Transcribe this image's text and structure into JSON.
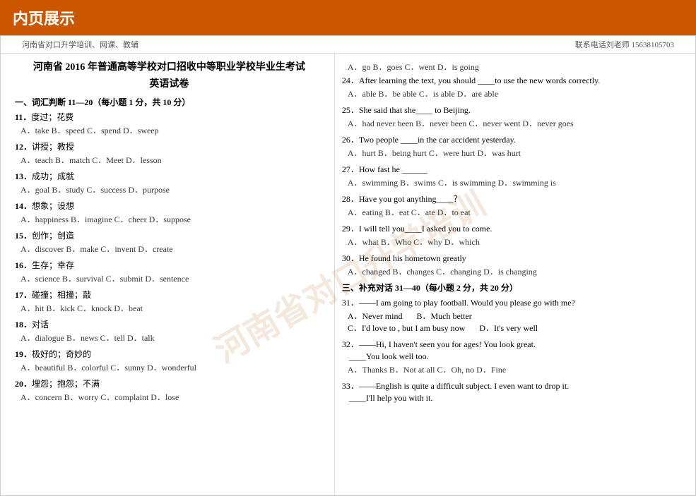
{
  "banner": {
    "title": "内页展示"
  },
  "header": {
    "left": "河南省对口升学培训、网课、教辅",
    "right": "联系电话刘老师 15638105703"
  },
  "exam": {
    "title": "河南省 2016 年普通高等学校对口招收中等职业学校毕业生考试",
    "subtitle": "英语试卷",
    "section1": {
      "header": "一、词汇判断 11—20（每小题 1 分，共 10 分）",
      "questions": [
        {
          "num": "11",
          "zh": "度过；花费",
          "options": "A．take   B．speed   C．spend   D．sweep"
        },
        {
          "num": "12",
          "zh": "讲授；教授",
          "options": "A．teach  B．match  C．Meet   D．lesson"
        },
        {
          "num": "13",
          "zh": "成功；成就",
          "options": "A．goal  B．study  C．success  D．purpose"
        },
        {
          "num": "14",
          "zh": "想象；设想",
          "options": "A．happiness  B．imagine  C．cheer  D．suppose"
        },
        {
          "num": "15",
          "zh": "创作；创造",
          "options": "A．discover  B．make   C．invent  D．create"
        },
        {
          "num": "16",
          "zh": "生存；幸存",
          "options": "A．science  B．survival  C．submit  D．sentence"
        },
        {
          "num": "17",
          "zh": "碰撞；相撞；敲",
          "options": "A．hit     B．kick    C．knock   D．beat"
        },
        {
          "num": "18",
          "zh": "对话",
          "options": "A．dialogue  B．news  C．tell  D．talk"
        },
        {
          "num": "19",
          "zh": "极好的；奇妙的",
          "options": "A．beautiful  B．colorful  C．sunny  D．wonderful"
        },
        {
          "num": "20",
          "zh": "埋怨；抱怨；不满",
          "options": "A．concern  B．worry  C．complaint  D．lose"
        }
      ]
    }
  },
  "right_section": {
    "intro_options": "A．go   B．goes   C．went   D．is going",
    "q24": {
      "text": "24．After learning the text, you should ____to use the new words correctly.",
      "options": "A．able   B．be able  C．is able   D．are able"
    },
    "q25": {
      "text": "25．She said that she____ to Beijing.",
      "options": "A．had never been   B．never been  C．never went  D．never goes"
    },
    "q26": {
      "text": "26．Two people ____in the car accident yesterday.",
      "options": "A．hurt    B．being hurt   C．were hurt   D．was hurt"
    },
    "q27": {
      "text": "27．How fast he ______",
      "options": "A．swimming  B．swims   C．is swimming  D．swimming is"
    },
    "q28": {
      "text": "28．Have you got anything____？",
      "options": "A．eating   B．eat    C．ate    D．to eat"
    },
    "q29": {
      "text": "29．I will tell you____I asked you to come.",
      "options": "A．what    B．Who    C．why    D．which"
    },
    "q30": {
      "text": "30．He found his hometown greatly",
      "options": "A．changed   B．changes  C．changing  D．is changing"
    },
    "section3": {
      "header": "三、补充对话 31—40（每小题 2 分，共 20 分）",
      "q31": {
        "text": "31．——I am going to play football. Would you please go with me?",
        "opt_a": "A．Never mind",
        "opt_b": "B．Much better",
        "opt_c": "C．I'd love to , but I am busy now",
        "opt_d": "D．It's very well"
      },
      "q32": {
        "text": "32．——Hi, I haven't seen you for ages! You look great.",
        "blank": "____You look well too.",
        "options": "A．Thanks   B．Not at all   C．Oh, no   D．Fine"
      },
      "q33": {
        "text": "33．——English is quite a difficult subject. I even want to drop it.",
        "blank": "____I'll help you with it."
      }
    }
  },
  "watermark": "河南省对口升学培训"
}
